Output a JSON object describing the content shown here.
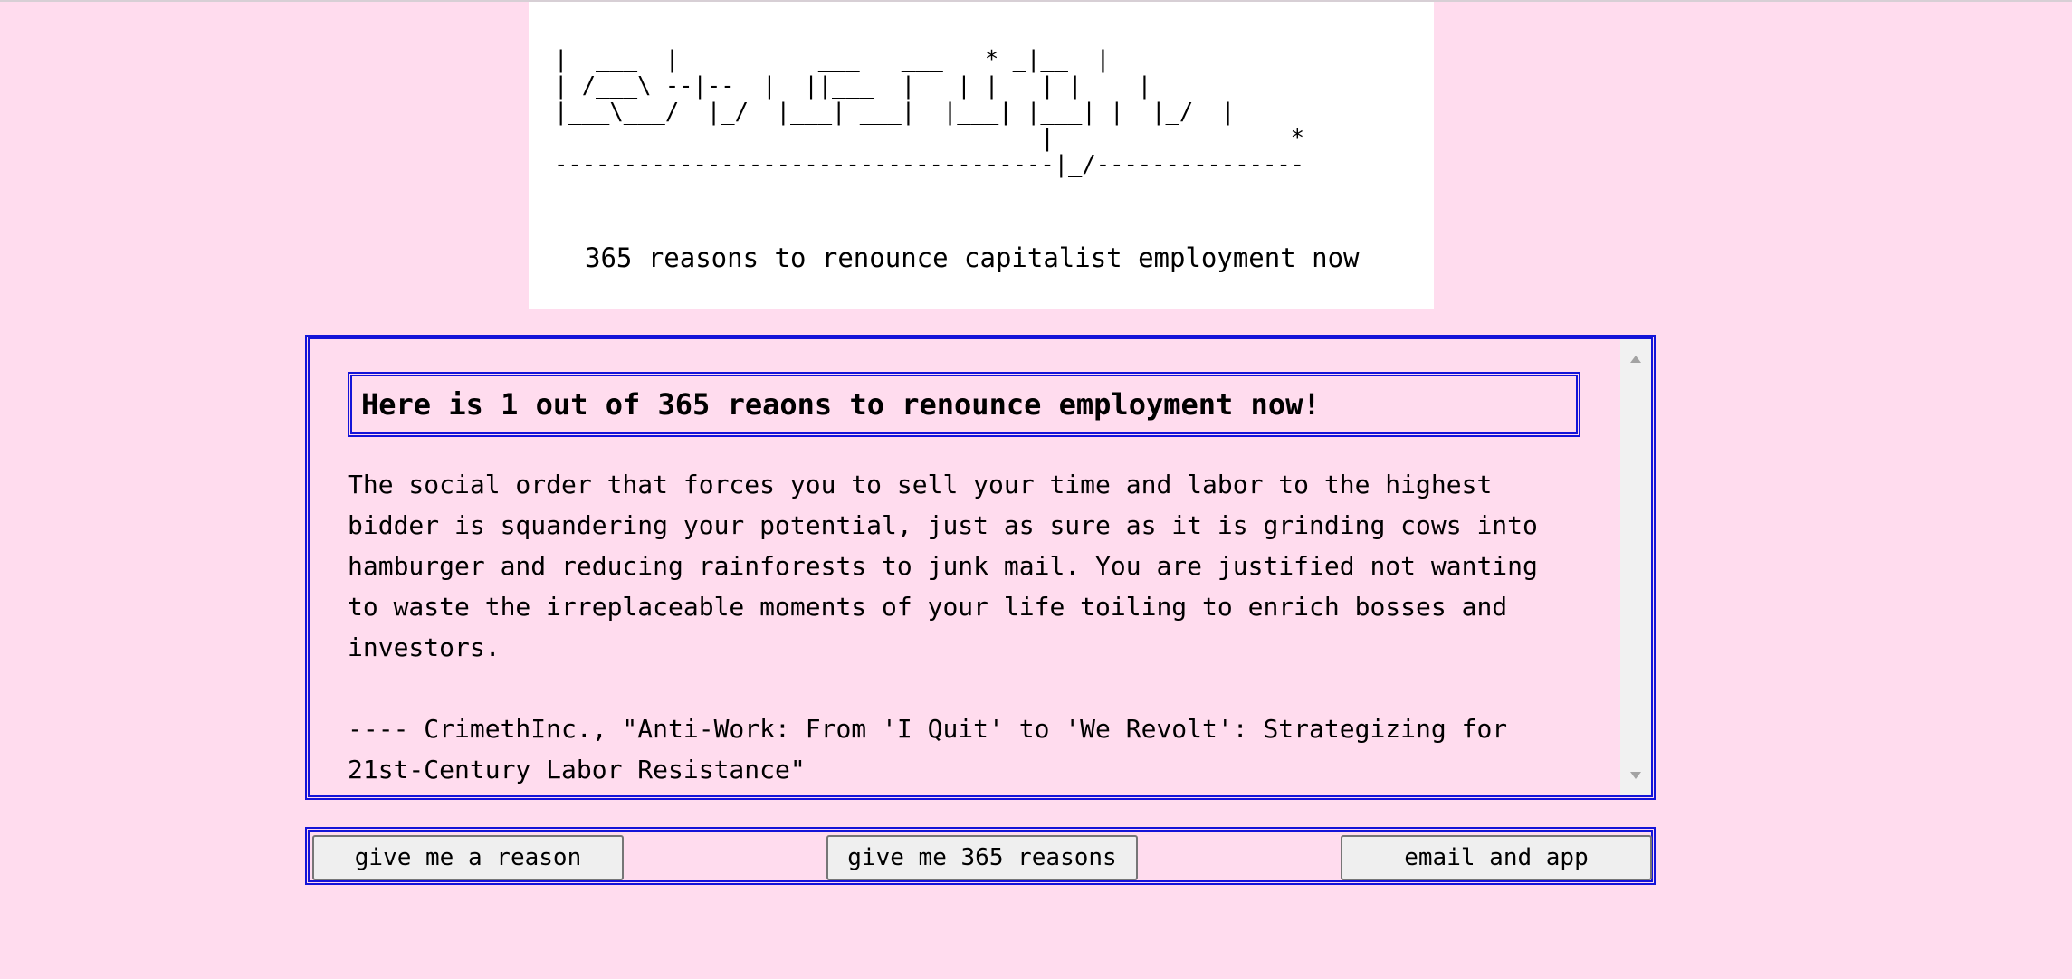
{
  "banner": {
    "ascii_art": "|  ___  |          ___   ___   * _|__  |\n| /___\\ --|--  |  ||___  |   | |   | |    |\n|___\\___/  |_/  |___| ___|  |___| |___| |  |_/  |\n                                   |                 *\n------------------------------------|_/---------------",
    "tagline": "365 reasons to renounce capitalist employment now"
  },
  "reason": {
    "heading": "Here is 1 out of 365 reaons to renounce employment now!",
    "text": "The social order that forces you to sell your time and labor to the highest bidder is squandering your potential, just as sure as it is grinding cows into hamburger and reducing rainforests to junk mail. You are justified not wanting to waste the irreplaceable moments of your life toiling to enrich bosses and investors.",
    "attribution": "---- CrimethInc., \"Anti-Work: From 'I Quit' to 'We Revolt': Strategizing for 21st-Century Labor Resistance\""
  },
  "buttons": {
    "reason_label": "give me a reason",
    "all_label": "give me 365 reasons",
    "email_label": "email and app"
  },
  "colors": {
    "background": "#ffdcee",
    "border": "#1414d8",
    "banner_bg": "#ffffff"
  }
}
